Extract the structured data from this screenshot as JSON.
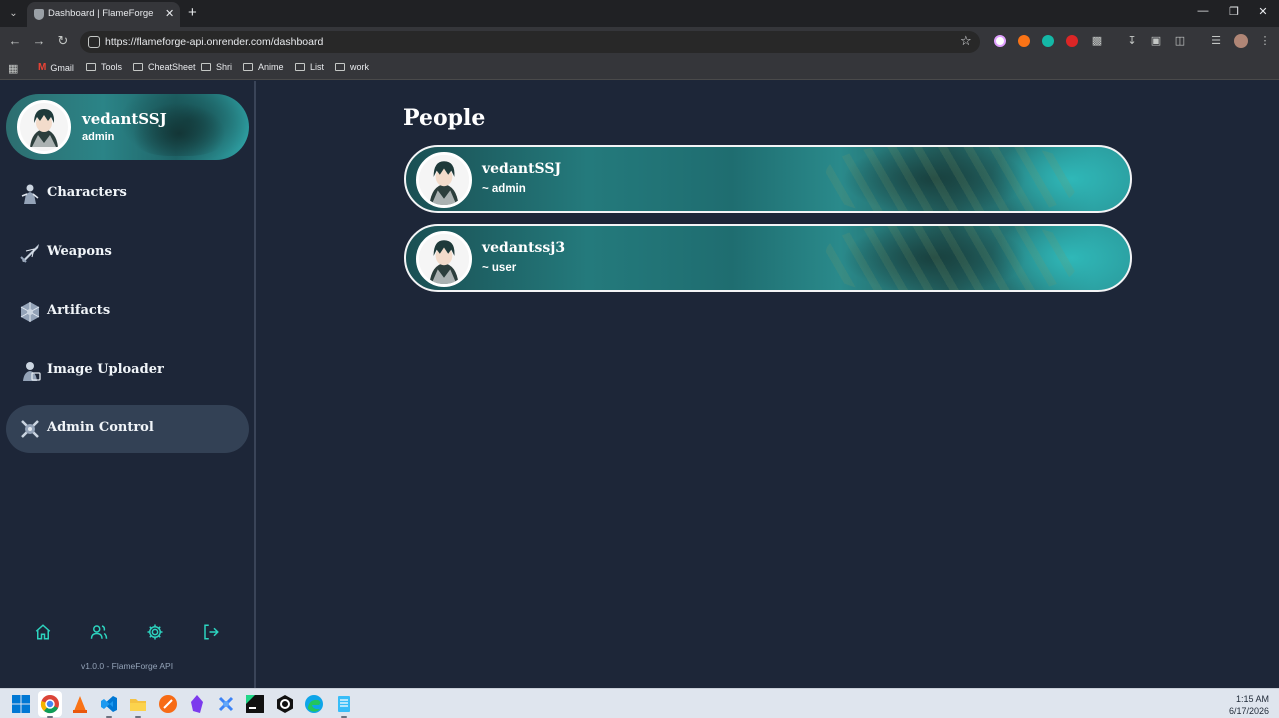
{
  "browser": {
    "tab_title": "Dashboard | FlameForge",
    "url": "https://flameforge-api.onrender.com/dashboard",
    "bookmarks": [
      "Gmail",
      "Tools",
      "CheatSheet",
      "Shri",
      "Anime",
      "List",
      "work"
    ]
  },
  "sidebar": {
    "profile": {
      "name": "vedantSSJ",
      "role": "admin"
    },
    "items": [
      {
        "label": "Characters",
        "icon": "character-icon"
      },
      {
        "label": "Weapons",
        "icon": "sword-icon"
      },
      {
        "label": "Artifacts",
        "icon": "artifact-icon"
      },
      {
        "label": "Image Uploader",
        "icon": "image-upload-icon"
      },
      {
        "label": "Admin Control",
        "icon": "admin-icon",
        "active": true
      }
    ],
    "bottom_icons": [
      "home-icon",
      "users-icon",
      "gear-icon",
      "logout-icon"
    ],
    "version": "v1.0.0 - FlameForge API"
  },
  "main": {
    "title": "People",
    "people": [
      {
        "name": "vedantSSJ",
        "role": "~ admin"
      },
      {
        "name": "vedantssj3",
        "role": "~ user"
      }
    ]
  },
  "taskbar": {
    "time": "1:15 AM",
    "date": "6/17/2026"
  },
  "colors": {
    "background": "#1d2638",
    "active_item": "#334155",
    "accent_teal": "#2b8487"
  }
}
